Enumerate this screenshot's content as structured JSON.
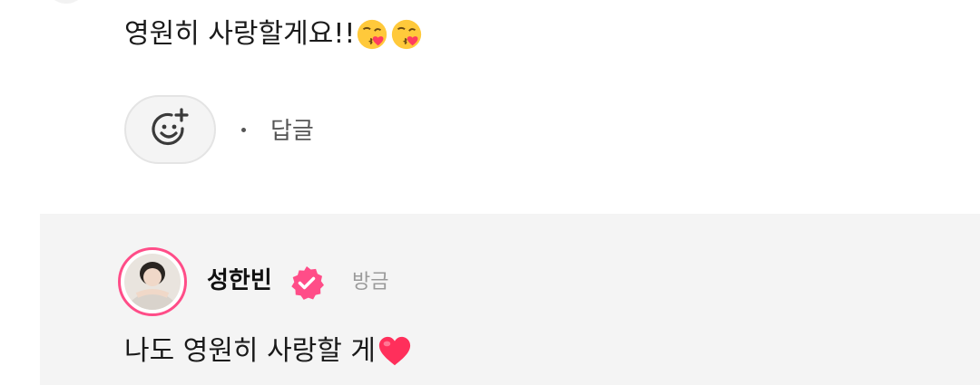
{
  "comment": {
    "text": "영원히 사랑할게요!!",
    "emojis": [
      "kissing-heart-emoji",
      "kissing-heart-emoji"
    ]
  },
  "actions": {
    "reaction_icon": "add-reaction-smiley-icon",
    "separator": "·",
    "reply_label": "답글"
  },
  "reply": {
    "author": "성한빈",
    "verified_icon": "verified-badge-icon",
    "time": "방금",
    "text": "나도 영원히 사랑할 게",
    "trailing_emoji": "red-heart-emoji"
  },
  "colors": {
    "accent_pink": "#ff4d88",
    "reply_background": "#f4f4f4",
    "muted_text": "#9a9a9a"
  }
}
